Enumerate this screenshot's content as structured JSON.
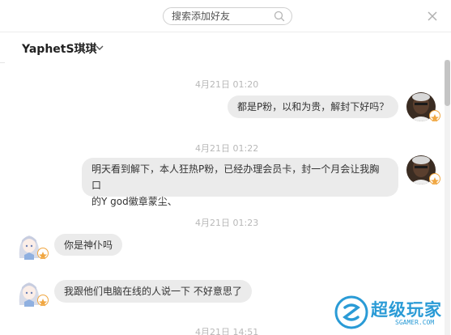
{
  "search": {
    "placeholder": "搜索添加好友"
  },
  "chat": {
    "title": "YaphetS琪琪"
  },
  "messages": [
    {
      "time": "4月21日 01:20",
      "text": "都是P粉，以和为贵，解封下好吗？",
      "side": "right"
    },
    {
      "time": "4月21日 01:22",
      "text_line1": "明天看到解下，本人狂热P粉，已经办理会员卡，封一个月会让我胸口",
      "text_line2": "的Y god徽章蒙尘、",
      "side": "right"
    },
    {
      "time": "4月21日 01:23",
      "text": "你是神仆吗",
      "side": "left"
    },
    {
      "text": "我跟他们电脑在线的人说一下 不好意思了",
      "side": "left"
    },
    {
      "time": "4月21日 14:51"
    }
  ],
  "watermark": {
    "name": "超级玩家",
    "sub": "SGAMER.COM"
  },
  "colors": {
    "bubble": "#ebebeb",
    "time": "#b8b8b8",
    "accent": "#2a9bd6",
    "badge": "#f0a640"
  }
}
